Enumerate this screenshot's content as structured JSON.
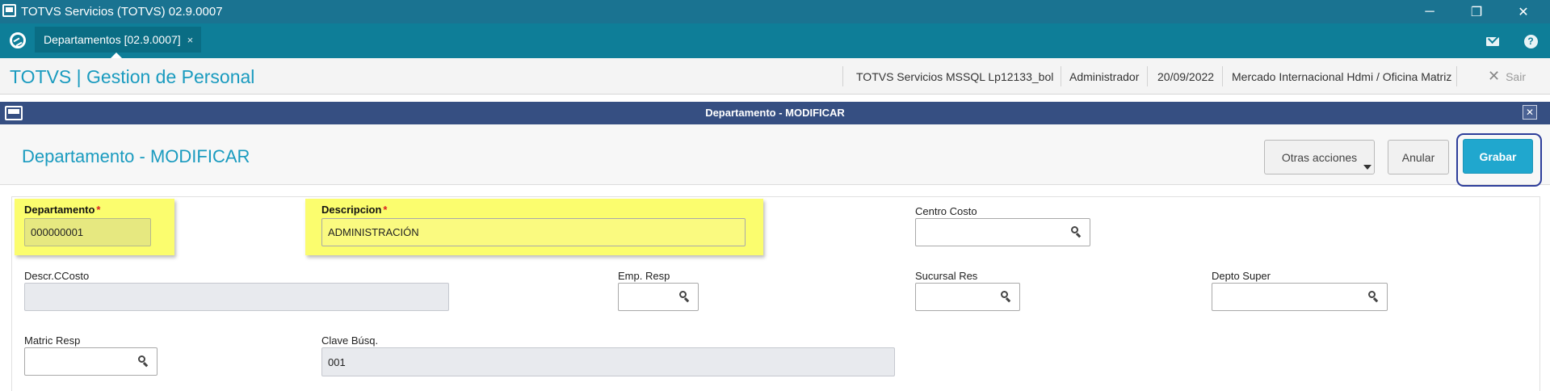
{
  "window": {
    "title": "TOTVS Servicios (TOTVS) 02.9.0007",
    "minimize_glyph": "─",
    "restore_glyph": "❐",
    "close_glyph": "✕"
  },
  "tabbar": {
    "tabs": [
      {
        "label": "Departamentos [02.9.0007]",
        "close_glyph": "×"
      }
    ],
    "icons": [
      "mail-icon",
      "help-icon"
    ]
  },
  "header": {
    "app_title": "TOTVS | Gestion de Personal",
    "environment": "TOTVS Servicios MSSQL Lp12133_bol",
    "user": "Administrador",
    "date": "20/09/2022",
    "company": "Mercado Internacional Hdmi / Oficina Matriz",
    "exit_label": "Sair",
    "exit_glyph": "✕"
  },
  "dialog": {
    "title": "Departamento - MODIFICAR",
    "close_glyph": "✕"
  },
  "page": {
    "title": "Departamento - MODIFICAR",
    "buttons": {
      "other_actions": "Otras acciones",
      "cancel": "Anular",
      "save": "Grabar"
    }
  },
  "form": {
    "departamento": {
      "label": "Departamento",
      "required_mark": "*",
      "value": "000000001"
    },
    "descripcion": {
      "label": "Descripcion",
      "required_mark": "*",
      "value": "ADMINISTRACIÓN"
    },
    "centro_costo": {
      "label": "Centro Costo",
      "value": ""
    },
    "descr_ccosto": {
      "label": "Descr.CCosto",
      "value": ""
    },
    "emp_resp": {
      "label": "Emp. Resp",
      "value": ""
    },
    "sucursal_res": {
      "label": "Sucursal Res",
      "value": ""
    },
    "depto_super": {
      "label": "Depto Super",
      "value": ""
    },
    "matric_resp": {
      "label": "Matric Resp",
      "value": ""
    },
    "clave_busq": {
      "label": "Clave Búsq.",
      "value": "001"
    }
  },
  "colors": {
    "titlebar": "#1a7391",
    "tabbar": "#0e7e98",
    "accent": "#1a9bbf",
    "dialog_bar": "#364f82",
    "primary_button": "#20a7ce",
    "highlight": "#fbfd6e"
  }
}
